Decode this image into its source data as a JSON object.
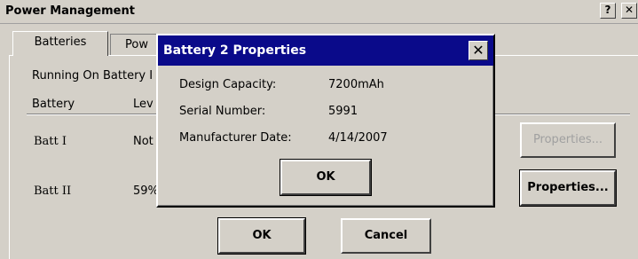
{
  "window": {
    "title": "Power Management",
    "help_label": "?",
    "close_label": "✕"
  },
  "tabs": [
    {
      "label": "Batteries"
    },
    {
      "label": "Pow"
    }
  ],
  "status_text": "Running On Battery I",
  "columns": {
    "battery": "Battery",
    "level": "Lev"
  },
  "rows": [
    {
      "name": "Batt I",
      "level": "Not"
    },
    {
      "name": "Batt II",
      "level": "59%"
    }
  ],
  "properties_buttons": [
    "Properties...",
    "Properties..."
  ],
  "footer": {
    "ok_label": "OK",
    "cancel_label": "Cancel"
  },
  "dialog": {
    "title": "Battery 2 Properties",
    "close_label": "✕",
    "fields": [
      {
        "label": "Design Capacity:",
        "value": "7200mAh"
      },
      {
        "label": "Serial Number:",
        "value": "5991"
      },
      {
        "label": "Manufacturer Date:",
        "value": "4/14/2007"
      }
    ],
    "ok_label": "OK"
  },
  "colors": {
    "dialog_title_bg": "#0a0a8a",
    "face": "#d4d0c8"
  }
}
